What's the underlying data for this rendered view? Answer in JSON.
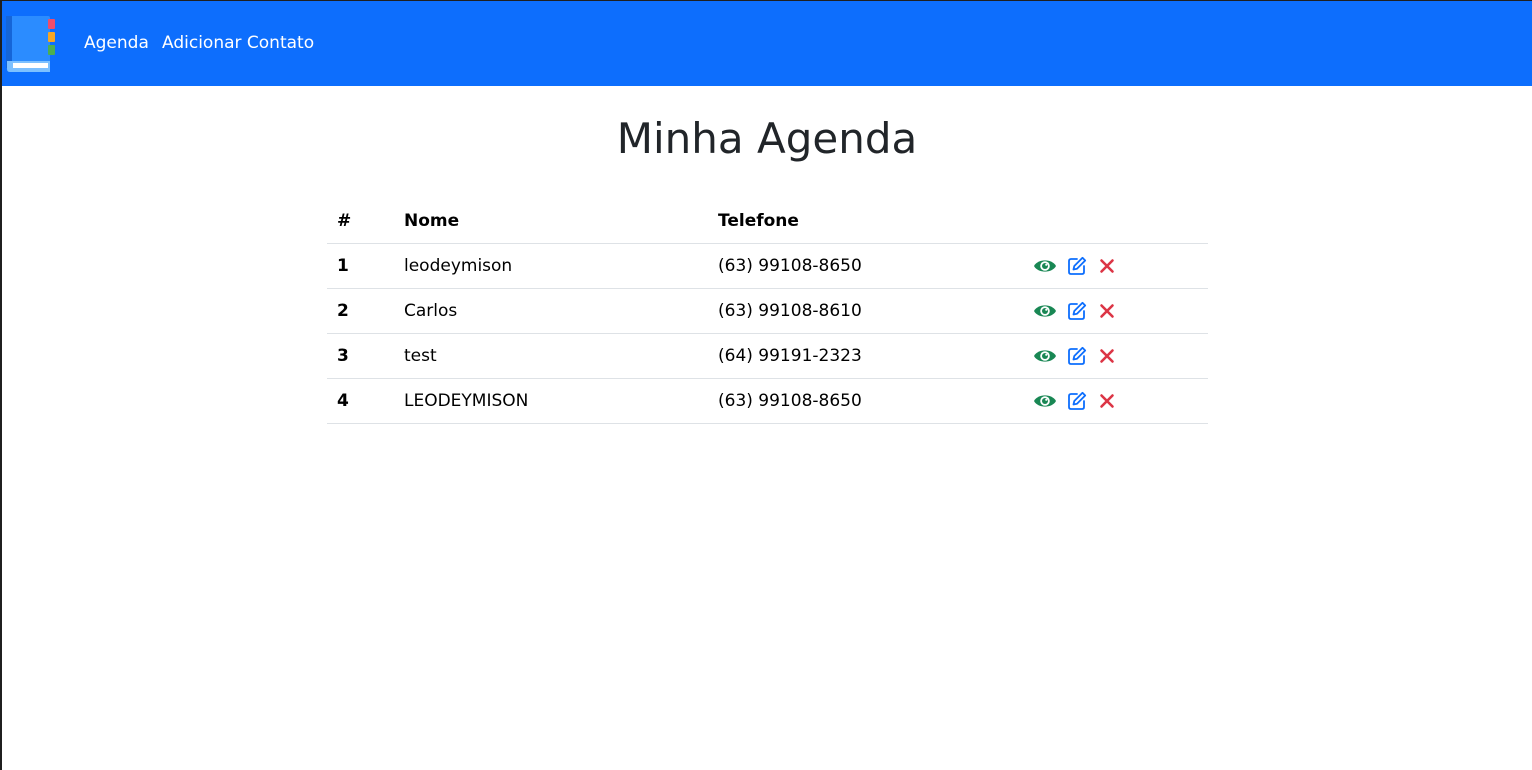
{
  "navbar": {
    "logo_icon": "address-book-icon",
    "links": [
      {
        "label": "Agenda"
      },
      {
        "label": "Adicionar Contato"
      }
    ],
    "background_color": "#0d6efd"
  },
  "page": {
    "title": "Minha Agenda"
  },
  "table": {
    "headers": {
      "num": "#",
      "name": "Nome",
      "phone": "Telefone",
      "actions": ""
    },
    "rows": [
      {
        "num": "1",
        "name": "leodeymison",
        "phone": "(63) 99108-8650"
      },
      {
        "num": "2",
        "name": "Carlos",
        "phone": "(63) 99108-8610"
      },
      {
        "num": "3",
        "name": "test",
        "phone": "(64) 99191-2323"
      },
      {
        "num": "4",
        "name": "LEODEYMISON",
        "phone": "(63) 99108-8650"
      }
    ],
    "row_actions": [
      {
        "icon": "eye-icon",
        "color": "#198754"
      },
      {
        "icon": "edit-icon",
        "color": "#0d6efd"
      },
      {
        "icon": "close-icon",
        "color": "#dc3545"
      }
    ]
  }
}
